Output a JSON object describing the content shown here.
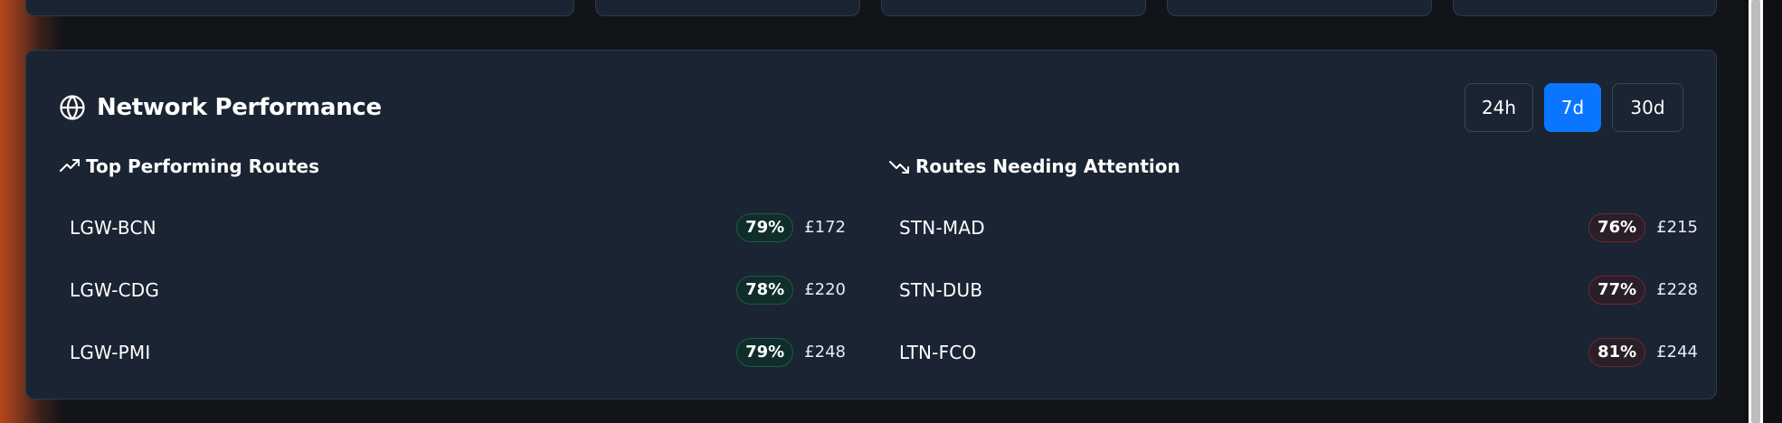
{
  "panel": {
    "title": "Network Performance",
    "icon": "globe-icon"
  },
  "range": {
    "options": [
      "24h",
      "7d",
      "30d"
    ],
    "selected": "7d"
  },
  "top_routes": {
    "title": "Top Performing Routes",
    "icon": "trending-up-icon",
    "items": [
      {
        "route": "LGW-BCN",
        "load": "79%",
        "fare": "£172"
      },
      {
        "route": "LGW-CDG",
        "load": "78%",
        "fare": "£220"
      },
      {
        "route": "LGW-PMI",
        "load": "79%",
        "fare": "£248"
      }
    ]
  },
  "attention_routes": {
    "title": "Routes Needing Attention",
    "icon": "trending-down-icon",
    "items": [
      {
        "route": "STN-MAD",
        "load": "76%",
        "fare": "£215"
      },
      {
        "route": "STN-DUB",
        "load": "77%",
        "fare": "£228"
      },
      {
        "route": "LTN-FCO",
        "load": "81%",
        "fare": "£244"
      }
    ]
  },
  "colors": {
    "accent": "#0a76ff",
    "card": "#1b2432",
    "good_badge": "#0f2e2b",
    "bad_badge": "#2a1e28"
  }
}
